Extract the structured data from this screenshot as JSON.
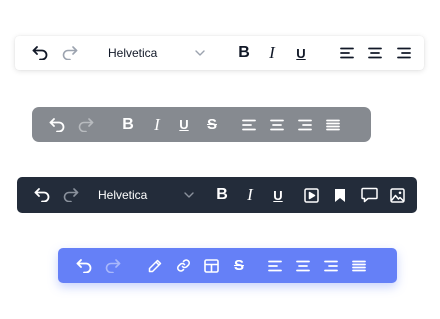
{
  "toolbar_light": {
    "font": "Helvetica",
    "bold": "B",
    "italic": "I",
    "underline": "U",
    "icons": [
      "undo-icon",
      "redo-icon",
      "chevron-down-icon",
      "align-left-icon",
      "align-center-icon",
      "align-right-icon"
    ]
  },
  "toolbar_gray": {
    "bold": "B",
    "italic": "I",
    "underline": "U",
    "strike": "S",
    "icons": [
      "undo-icon",
      "redo-icon",
      "align-left-icon",
      "align-center-icon",
      "align-right-icon",
      "align-justify-icon"
    ]
  },
  "toolbar_dark": {
    "font": "Helvetica",
    "bold": "B",
    "italic": "I",
    "underline": "U",
    "icons": [
      "undo-icon",
      "redo-icon",
      "chevron-down-icon",
      "video-icon",
      "bookmark-icon",
      "comment-icon",
      "image-icon"
    ]
  },
  "toolbar_blue": {
    "strike": "S",
    "icons": [
      "undo-icon",
      "redo-icon",
      "pen-icon",
      "link-icon",
      "table-icon",
      "align-left-icon",
      "align-center-icon",
      "align-right-icon",
      "align-justify-icon"
    ]
  },
  "colors": {
    "light_bg": "#ffffff",
    "gray_bg": "#868a90",
    "dark_bg": "#232c3a",
    "blue_bg": "#6580f7",
    "redo_dim_light": "#9ca3af",
    "redo_dim_gray": "#b8bbbf",
    "redo_dim_dark": "#8a919c",
    "redo_dim_blue": "#a9b8fb"
  }
}
